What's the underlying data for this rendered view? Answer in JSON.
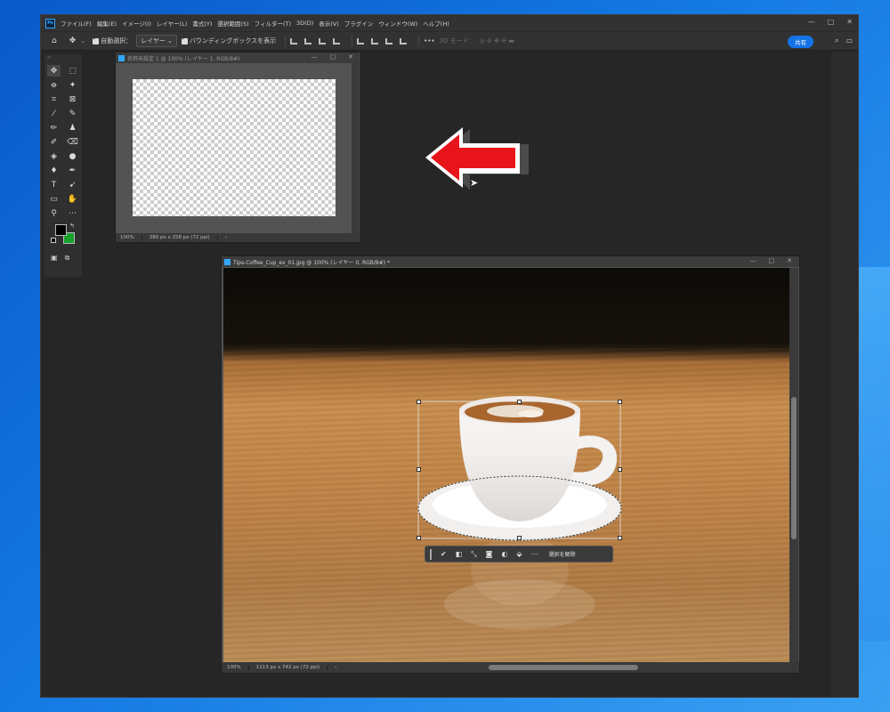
{
  "app": {
    "logo": "Ps",
    "menu": [
      "ファイル(F)",
      "編集(E)",
      "イメージ(I)",
      "レイヤー(L)",
      "書式(Y)",
      "選択範囲(S)",
      "フィルター(T)",
      "3D(D)",
      "表示(V)",
      "プラグイン",
      "ウィンドウ(W)",
      "ヘルプ(H)"
    ],
    "window_controls": [
      "—",
      "□",
      "✕"
    ]
  },
  "options_bar": {
    "auto_select_label": "自動選択：",
    "layer_select_value": "レイヤー",
    "bounding_box_label": "バウンディングボックスを表示",
    "more_label": "•••",
    "mode_3d_label": "3D モード：",
    "share_label": "共有"
  },
  "documents": {
    "untitled": {
      "title": "名称未設定 1 @ 100% (レイヤー 1, RGB/8#)",
      "zoom": "100%",
      "info": "380 px x 258 px (72 ppi)",
      "nav": "›"
    },
    "coffee": {
      "title": "Tips-Coffee_Cup_ex_01.jpg @ 100% (レイヤー 0, RGB/8#) *",
      "zoom": "100%",
      "info": "1113 px x 742 px (72 ppi)",
      "nav": "›"
    }
  },
  "contextual_taskbar": {
    "deselect_label": "選択を解除"
  },
  "icons": [
    "home-icon",
    "move-icon",
    "artboard-icon",
    "marquee-icon",
    "lasso-icon",
    "magic-wand-icon",
    "crop-icon",
    "frame-icon",
    "eyedropper-icon",
    "healing-icon",
    "brush-icon",
    "stamp-icon",
    "history-brush-icon",
    "eraser-icon",
    "bucket-icon",
    "blur-icon",
    "dodge-icon",
    "pen-icon",
    "type-icon",
    "path-select-icon",
    "rectangle-icon",
    "hand-icon",
    "zoom-icon",
    "more-icon",
    "search-icon",
    "workspace-icon"
  ],
  "colors": {
    "foreground": "#000000",
    "background": "#16a02c",
    "accent": "#1473e6",
    "arrow": "#e8141b"
  }
}
